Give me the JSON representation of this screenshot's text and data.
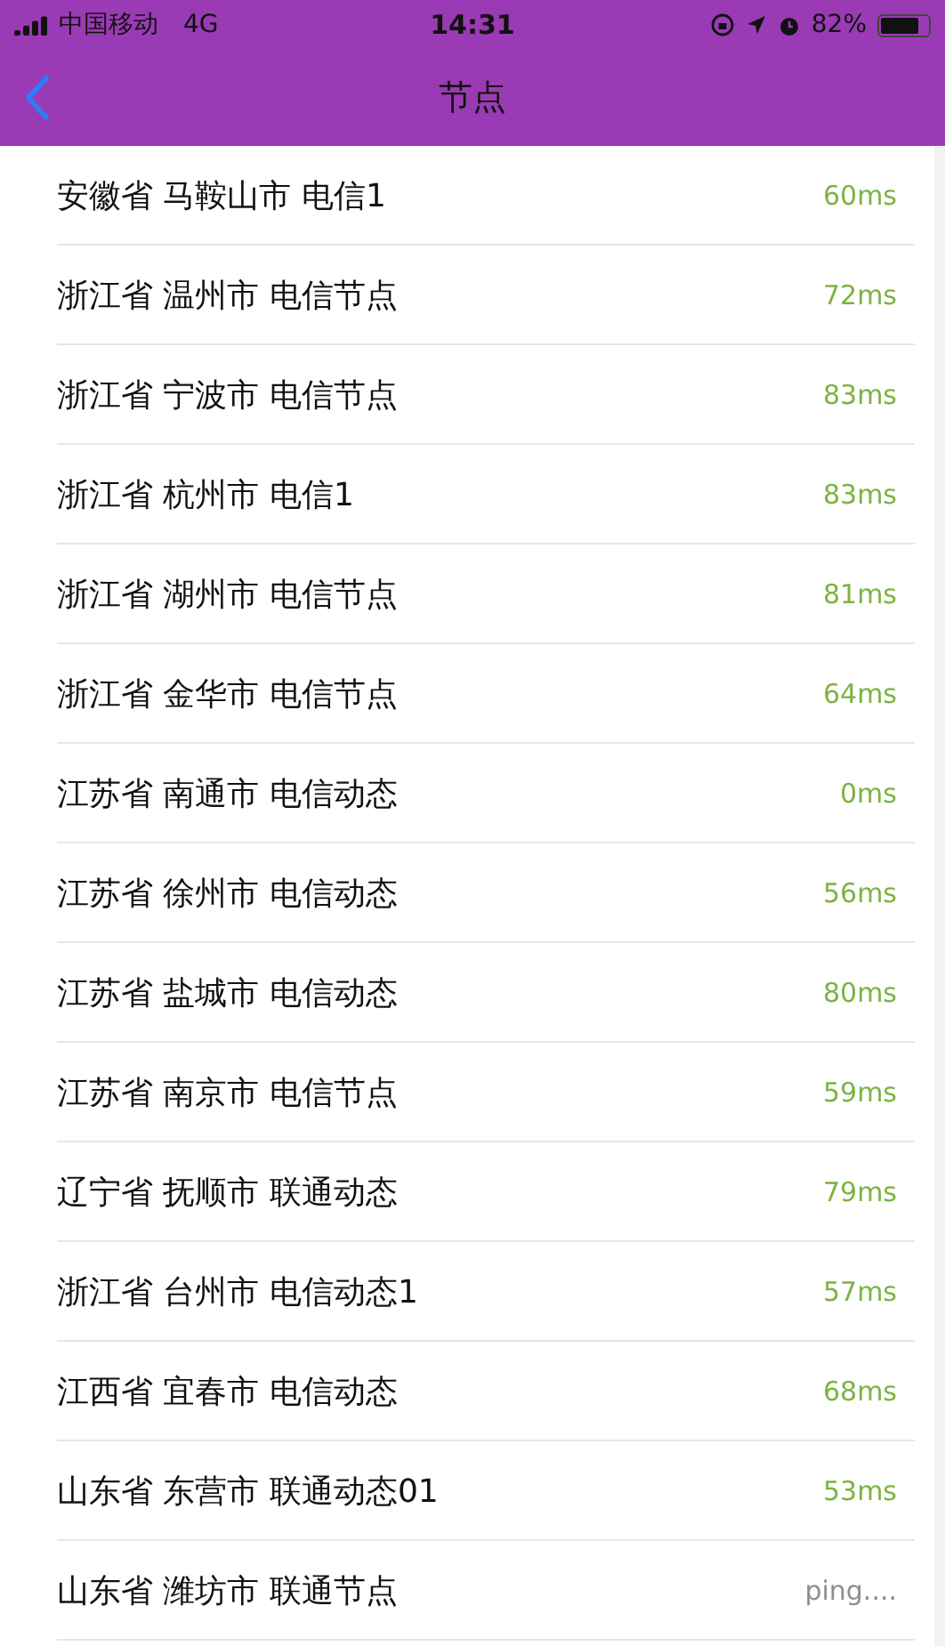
{
  "status_bar": {
    "carrier": "中国移动",
    "network": "4G",
    "time": "14:31",
    "battery": "82%"
  },
  "nav": {
    "title": "节点"
  },
  "nodes": [
    {
      "name": "安徽省 马鞍山市 电信1",
      "latency": "60ms",
      "kind": "result"
    },
    {
      "name": "浙江省 温州市 电信节点",
      "latency": "72ms",
      "kind": "result"
    },
    {
      "name": "浙江省 宁波市 电信节点",
      "latency": "83ms",
      "kind": "result"
    },
    {
      "name": "浙江省 杭州市 电信1",
      "latency": "83ms",
      "kind": "result"
    },
    {
      "name": "浙江省 湖州市 电信节点",
      "latency": "81ms",
      "kind": "result"
    },
    {
      "name": "浙江省 金华市 电信节点",
      "latency": "64ms",
      "kind": "result"
    },
    {
      "name": "江苏省 南通市 电信动态",
      "latency": "0ms",
      "kind": "result"
    },
    {
      "name": "江苏省 徐州市 电信动态",
      "latency": "56ms",
      "kind": "result"
    },
    {
      "name": "江苏省 盐城市 电信动态",
      "latency": "80ms",
      "kind": "result"
    },
    {
      "name": "江苏省 南京市 电信节点",
      "latency": "59ms",
      "kind": "result"
    },
    {
      "name": "辽宁省 抚顺市 联通动态",
      "latency": "79ms",
      "kind": "result"
    },
    {
      "name": "浙江省 台州市 电信动态1",
      "latency": "57ms",
      "kind": "result"
    },
    {
      "name": "江西省 宜春市 电信动态",
      "latency": "68ms",
      "kind": "result"
    },
    {
      "name": "山东省 东营市 联通动态01",
      "latency": "53ms",
      "kind": "result"
    },
    {
      "name": "山东省 潍坊市 联通节点",
      "latency": "ping....",
      "kind": "pending"
    }
  ]
}
